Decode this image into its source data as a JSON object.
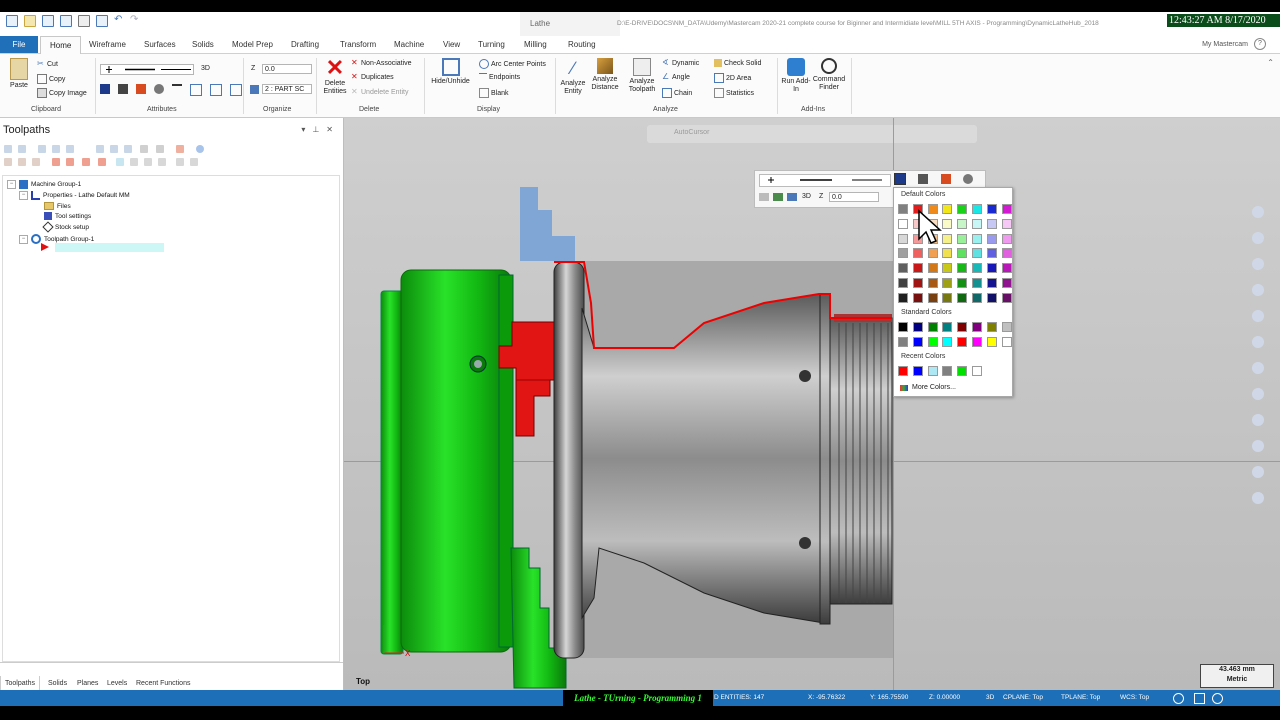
{
  "titlebar": {
    "app_name": "Lathe",
    "path": "D:\\E-DRIVE\\DOCS\\NM_DATA\\Udemy\\Mastercam 2020-21 complete course for Biginner and Intermidiate level\\MILL 5TH AXIS - Programming\\DynamicLatheHub_2018",
    "clock": "12:43:27 AM 8/17/2020"
  },
  "ribbon_tabs": [
    "File",
    "Home",
    "Wireframe",
    "Surfaces",
    "Solids",
    "Model Prep",
    "Drafting",
    "Transform",
    "Machine",
    "View",
    "Turning",
    "Milling",
    "Routing"
  ],
  "my_mastercam": "My Mastercam",
  "help_glyph": "?",
  "clipboard": {
    "paste": "Paste",
    "cut": "Cut",
    "copy": "Copy",
    "copy_image": "Copy Image",
    "label": "Clipboard"
  },
  "attributes": {
    "mode": "3D",
    "label": "Attributes"
  },
  "organize": {
    "z_label": "Z",
    "z_value": "0.0",
    "level": "2 : PART SC",
    "label": "Organize"
  },
  "delete": {
    "delete_entities": "Delete Entities",
    "non_associative": "Non-Associative",
    "duplicates": "Duplicates",
    "undelete": "Undelete Entity",
    "label": "Delete"
  },
  "display": {
    "hide_unhide": "Hide/Unhide",
    "arc_center": "Arc Center Points",
    "endpoints": "Endpoints",
    "blank": "Blank",
    "label": "Display"
  },
  "analyze": {
    "entity": "Analyze Entity",
    "distance": "Analyze Distance",
    "toolpath": "Analyze Toolpath",
    "dynamic": "Dynamic",
    "angle": "Angle",
    "chain": "Chain",
    "check_solid": "Check Solid",
    "area_2d": "2D Area",
    "statistics": "Statistics",
    "label": "Analyze"
  },
  "addins": {
    "run": "Run Add-In",
    "finder": "Command Finder",
    "label": "Add-Ins"
  },
  "panel": {
    "title": "Toolpaths",
    "tree": [
      {
        "label": "Machine Group-1"
      },
      {
        "label": "Properties - Lathe Default MM"
      },
      {
        "label": "Files"
      },
      {
        "label": "Tool settings"
      },
      {
        "label": "Stock setup"
      },
      {
        "label": "Toolpath Group-1"
      }
    ],
    "bottom_tabs": [
      "Toolpaths",
      "Solids",
      "Planes",
      "Levels",
      "Recent Functions"
    ]
  },
  "viewport": {
    "autocursor": "AutoCursor",
    "view_name": "Top",
    "scale_value": "43.463 mm",
    "scale_unit": "Metric",
    "minitoolbar_z_label": "Z",
    "minitoolbar_z": "0.0",
    "minitoolbar_mode": "3D"
  },
  "color_picker": {
    "default_title": "Default Colors",
    "standard_title": "Standard Colors",
    "recent_title": "Recent Colors",
    "more": "More Colors...",
    "default_colors": [
      [
        "#808080",
        "#e21b1b",
        "#f08a1a",
        "#f0e61a",
        "#1ad21a",
        "#1ae6e6",
        "#1a2ad2",
        "#d21ad2"
      ],
      [
        "#ffffff",
        "#f8c8c8",
        "#fadcc0",
        "#fafac8",
        "#c8f5c8",
        "#c8f5f5",
        "#c8c8f5",
        "#f5c8f5"
      ],
      [
        "#d8d8d8",
        "#f49a9a",
        "#f5c08a",
        "#f5f08a",
        "#9aef9a",
        "#9aefef",
        "#9a9aef",
        "#ef9aef"
      ],
      [
        "#a0a0a0",
        "#ef6060",
        "#f0a050",
        "#f0e050",
        "#60e060",
        "#60e0e0",
        "#6060e0",
        "#e060e0"
      ],
      [
        "#606060",
        "#c81818",
        "#d27818",
        "#c8c818",
        "#18b818",
        "#18b8b8",
        "#1818b8",
        "#b818b8"
      ],
      [
        "#404040",
        "#a01414",
        "#a85a14",
        "#a0a014",
        "#149014",
        "#149090",
        "#141490",
        "#901490"
      ],
      [
        "#202020",
        "#781010",
        "#784010",
        "#787810",
        "#106810",
        "#106868",
        "#101068",
        "#681068"
      ]
    ],
    "standard_colors": [
      [
        "#000000",
        "#000080",
        "#008000",
        "#008080",
        "#800000",
        "#800080",
        "#808000",
        "#c0c0c0"
      ],
      [
        "#808080",
        "#0000ff",
        "#00ff00",
        "#00ffff",
        "#ff0000",
        "#ff00ff",
        "#ffff00",
        "#ffffff"
      ]
    ],
    "recent_colors": [
      "#ff0000",
      "#0000ff",
      "#aee8f5",
      "#808080",
      "#00e000",
      "#ffffff"
    ]
  },
  "statusbar": {
    "lesson": "Lathe - TUrning - Programming 1",
    "entities": "D ENTITIES: 147",
    "x": "X:   -95.76322",
    "y": "Y:   165.75590",
    "z": "Z:   0.00000",
    "mode": "3D",
    "cplane": "CPLANE: Top",
    "tplane": "TPLANE: Top",
    "wcs": "WCS: Top"
  }
}
